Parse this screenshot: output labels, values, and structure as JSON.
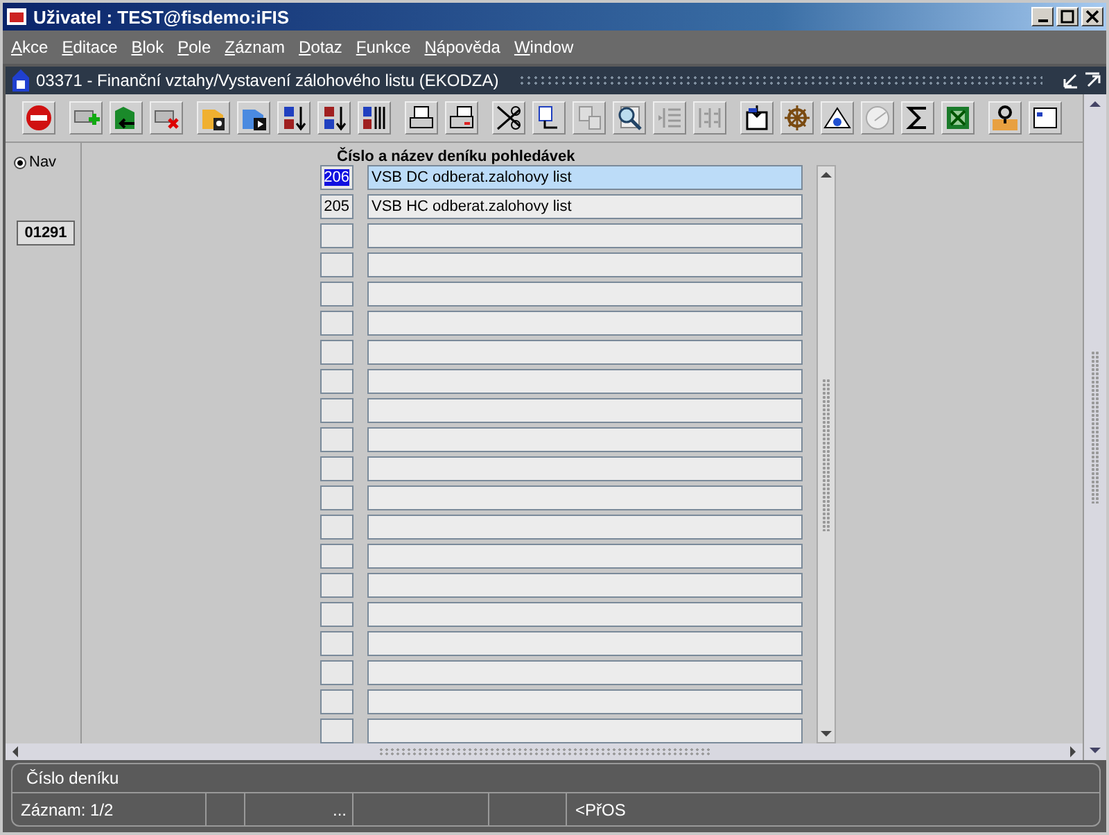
{
  "window": {
    "title": "Uživatel : TEST@fisdemo:iFIS"
  },
  "menu": [
    "Akce",
    "Editace",
    "Blok",
    "Pole",
    "Záznam",
    "Dotaz",
    "Funkce",
    "Nápověda",
    "Window"
  ],
  "form": {
    "title": "03371 - Finanční vztahy/Vystavení zálohového listu (EKODZA)"
  },
  "nav": {
    "label": "Nav",
    "selected": true,
    "code": "01291"
  },
  "table": {
    "heading": "Číslo a název deníku pohledávek",
    "rows": [
      {
        "number": "206",
        "name": "VSB DC odberat.zalohovy list",
        "selected": true
      },
      {
        "number": "205",
        "name": "VSB HC odberat.zalohovy list",
        "selected": false
      }
    ]
  },
  "status_bar": {
    "hint": "Číslo deníku",
    "record": "Záznam: 1/2",
    "cell_3": "...",
    "mode": "<PřOS"
  }
}
